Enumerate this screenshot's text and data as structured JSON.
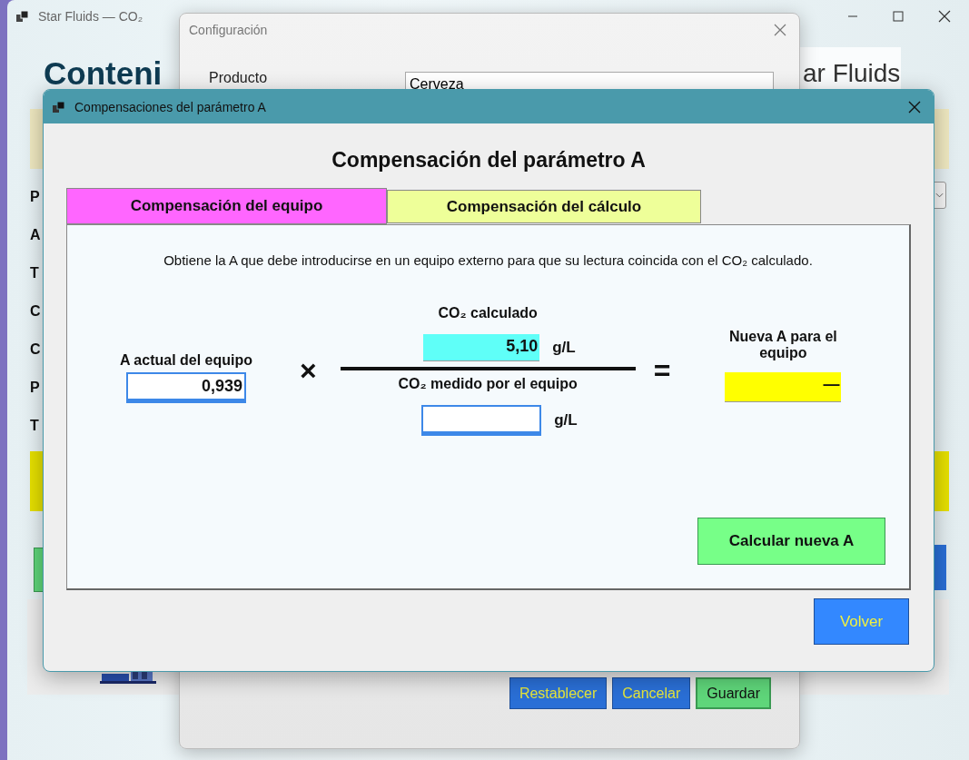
{
  "main_window": {
    "title": "Star Fluids — CO₂",
    "heading": "Conteni",
    "brand": "ar Fluids",
    "labels": [
      "P",
      "A",
      "T",
      "C",
      "C",
      "P",
      "T"
    ]
  },
  "config_dialog": {
    "title": "Configuración",
    "product_label": "Producto",
    "product_value": "Cerveza",
    "buttons": [
      {
        "label": "Restablecer",
        "kind": "secondary"
      },
      {
        "label": "Cancelar",
        "kind": "secondary"
      },
      {
        "label": "Guardar",
        "kind": "primary"
      }
    ]
  },
  "dialog": {
    "title": "Compensaciones del parámetro A",
    "heading": "Compensación del parámetro A",
    "tabs": [
      {
        "label": "Compensación del equipo",
        "selected": true
      },
      {
        "label": "Compensación del cálculo",
        "selected": false
      }
    ],
    "description": "Obtiene la A que debe introducirse en un equipo externo para que su lectura coincida con el CO₂ calculado.",
    "current_a": {
      "label": "A actual del equipo",
      "value": "0,939"
    },
    "times": "×",
    "calculated": {
      "label": "CO₂ calculado",
      "value": "5,10",
      "unit": "g/L"
    },
    "measured": {
      "label": "CO₂ medido por el equipo",
      "unit": "g/L"
    },
    "equals": "=",
    "result": {
      "label": "Nueva A para el equipo",
      "value": "—"
    },
    "calculate_button": "Calcular nueva A",
    "back_button": "Volver"
  }
}
